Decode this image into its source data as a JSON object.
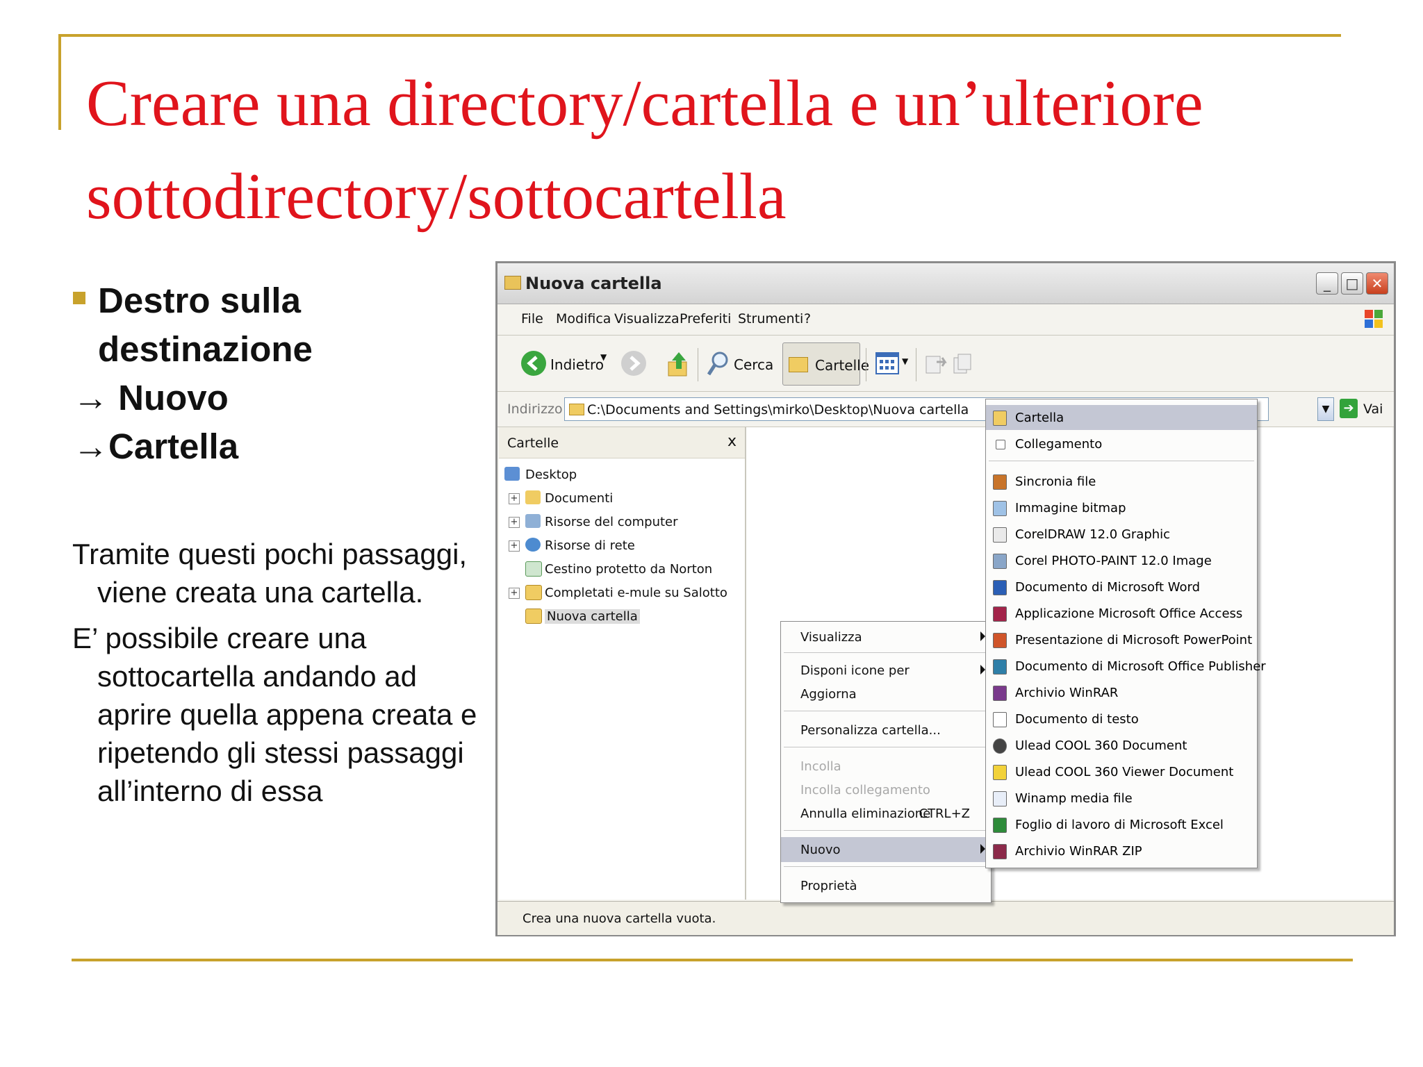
{
  "slide": {
    "title": "Creare una directory/cartella e un’ulteriore sottodirectory/sottocartella",
    "bullets": [
      "Destro sulla",
      "destinazione",
      "→ Nuovo",
      "→Cartella"
    ],
    "paragraphs": [
      "Tramite questi pochi passaggi, viene creata una cartella.",
      "E’ possibile creare una sottocartella andando ad aprire quella appena creata e ripetendo gli stessi passaggi all’interno di essa"
    ],
    "colors": {
      "title": "#e0141c",
      "accent_rule": "#c8a22c",
      "text": "#111111"
    }
  },
  "window": {
    "title": "Nuova cartella",
    "menu": [
      "File",
      "Modifica",
      "Visualizza",
      "Preferiti",
      "Strumenti",
      "?"
    ],
    "toolbar": {
      "back": "Indietro",
      "search": "Cerca",
      "folders": "Cartelle"
    },
    "address": {
      "label": "Indirizzo",
      "value": "C:\\Documents and Settings\\mirko\\Desktop\\Nuova cartella",
      "go": "Vai"
    },
    "folders_panel": {
      "title": "Cartelle",
      "close": "x",
      "tree": [
        {
          "label": "Desktop",
          "icon": "desktop-icon"
        },
        {
          "label": "Documenti",
          "icon": "documents-folder-icon"
        },
        {
          "label": "Risorse del computer",
          "icon": "computer-icon"
        },
        {
          "label": "Risorse di rete",
          "icon": "network-icon"
        },
        {
          "label": "Cestino protetto da Norton",
          "icon": "recycle-bin-icon"
        },
        {
          "label": "Completati e-mule su Salotto",
          "icon": "shared-folder-icon"
        },
        {
          "label": "Nuova cartella",
          "icon": "folder-icon"
        }
      ]
    },
    "status": "Crea una nuova cartella vuota."
  },
  "context_menu": {
    "items": [
      "Visualizza",
      "Disponi icone per",
      "Aggiorna",
      "Personalizza cartella...",
      "Incolla",
      "Incolla collegamento",
      "Annulla eliminazione",
      "Nuovo",
      "Proprietà"
    ],
    "shortcut": "CTRL+Z",
    "highlighted": "Nuovo"
  },
  "new_submenu": {
    "items": [
      {
        "label": "Cartella",
        "icon": "folder-icon",
        "color": "#f0cc62"
      },
      {
        "label": "Collegamento",
        "icon": "shortcut-icon",
        "color": "#ffffff"
      },
      {
        "label": "Sincronia file",
        "icon": "briefcase-icon",
        "color": "#c8742a"
      },
      {
        "label": "Immagine bitmap",
        "icon": "bitmap-icon",
        "color": "#9fc2e6"
      },
      {
        "label": "CorelDRAW 12.0 Graphic",
        "icon": "coreldraw-icon",
        "color": "#eaeaea"
      },
      {
        "label": "Corel PHOTO-PAINT 12.0 Image",
        "icon": "photopaint-icon",
        "color": "#8aa6c8"
      },
      {
        "label": "Documento di Microsoft Word",
        "icon": "word-icon",
        "color": "#2b5fb5"
      },
      {
        "label": "Applicazione Microsoft Office Access",
        "icon": "access-icon",
        "color": "#a3244a"
      },
      {
        "label": "Presentazione di Microsoft PowerPoint",
        "icon": "powerpoint-icon",
        "color": "#d0552a"
      },
      {
        "label": "Documento di Microsoft Office Publisher",
        "icon": "publisher-icon",
        "color": "#2f7fa8"
      },
      {
        "label": "Archivio WinRAR",
        "icon": "winrar-icon",
        "color": "#7a3a8c"
      },
      {
        "label": "Documento di testo",
        "icon": "text-document-icon",
        "color": "#ffffff"
      },
      {
        "label": "Ulead COOL 360 Document",
        "icon": "ulead-icon",
        "color": "#444444"
      },
      {
        "label": "Ulead COOL 360 Viewer Document",
        "icon": "ulead-viewer-icon",
        "color": "#f2d23a"
      },
      {
        "label": "Winamp media file",
        "icon": "winamp-icon",
        "color": "#e8eef8"
      },
      {
        "label": "Foglio di lavoro di Microsoft Excel",
        "icon": "excel-icon",
        "color": "#2e8b3a"
      },
      {
        "label": "Archivio WinRAR ZIP",
        "icon": "winrar-zip-icon",
        "color": "#8c2a4a"
      }
    ],
    "highlighted": "Cartella"
  }
}
